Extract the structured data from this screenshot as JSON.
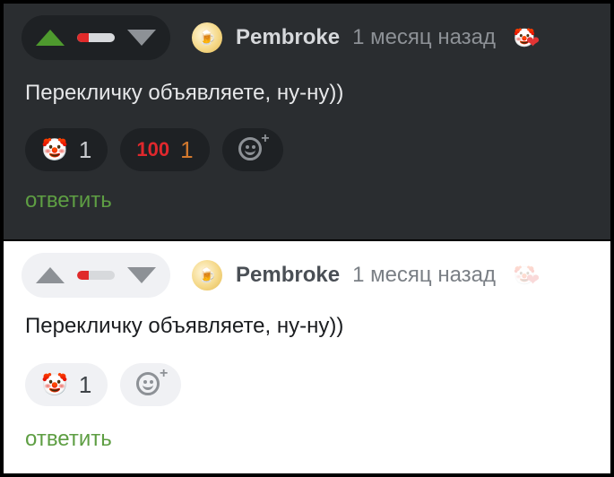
{
  "comments": [
    {
      "theme": "dark",
      "author": "Pembroke",
      "date": "1 месяц назад",
      "avatar_icon": "beer-mug-avatar",
      "rating_negative_fraction": 0.3,
      "text": "Перекличку объявляете, ну-ну))",
      "reactions": [
        {
          "icon": "clown-face",
          "emoji": "🤡",
          "count": "1"
        },
        {
          "icon": "hundred-points",
          "emoji": "100",
          "count": "1"
        }
      ],
      "reply_label": "ответить"
    },
    {
      "theme": "light",
      "author": "Pembroke",
      "date": "1 месяц назад",
      "avatar_icon": "beer-mug-avatar",
      "rating_negative_fraction": 0.3,
      "text": "Перекличку объявляете, ну-ну))",
      "reactions": [
        {
          "icon": "clown-face",
          "emoji": "🤡",
          "count": "1"
        }
      ],
      "reply_label": "ответить"
    }
  ],
  "colors": {
    "upvote_active": "#4e9a2e",
    "reply_link": "#5e9e43",
    "rating_negative": "#e02a2a",
    "hundred_count": "#d3792e"
  }
}
